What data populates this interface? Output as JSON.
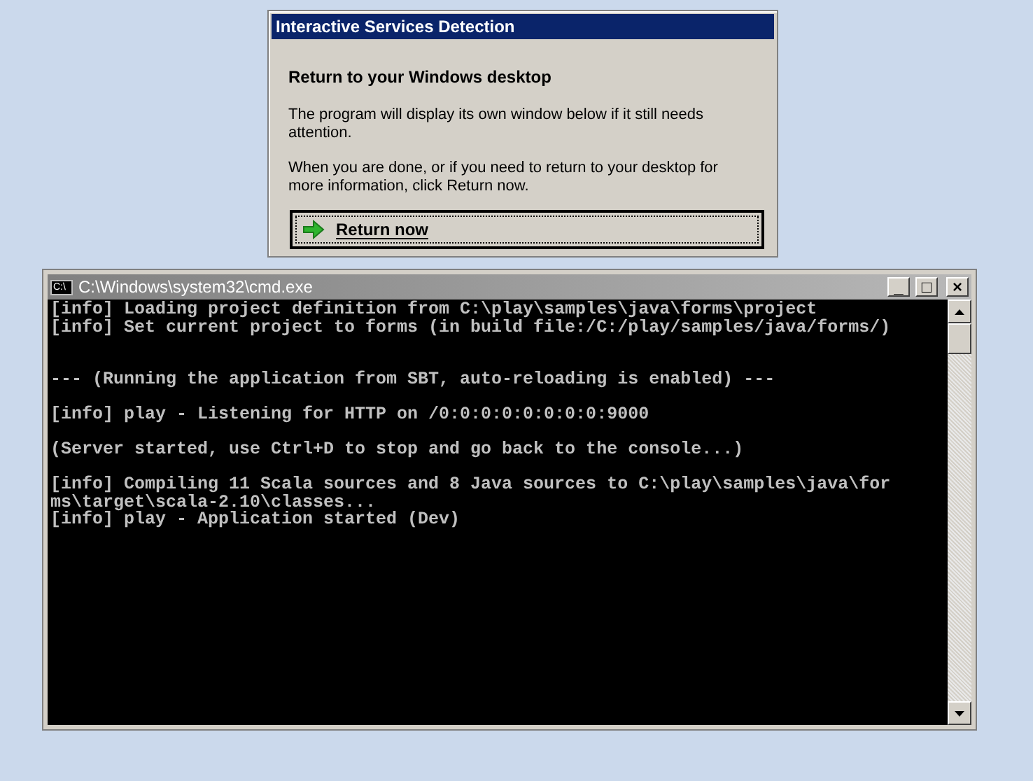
{
  "dialog": {
    "title": "Interactive Services Detection",
    "heading": "Return to your Windows desktop",
    "paragraphs": [
      "The program will display its own window below if it still needs attention.",
      "When you are done, or if you need to return to your desktop for more information, click Return now."
    ],
    "button": "Return now"
  },
  "console": {
    "title": "C:\\Windows\\system32\\cmd.exe",
    "icon_label": "C:\\",
    "controls": [
      "_",
      "□",
      "×"
    ],
    "blocks": [
      [
        "[info] Loading project definition from C:\\play\\samples\\java\\forms\\project",
        "[info] Set current project to forms (in build file:/C:/play/samples/java/forms/)"
      ],
      [
        "--- (Running the application from SBT, auto-reloading is enabled) ---"
      ],
      [
        "[info] play - Listening for HTTP on /0:0:0:0:0:0:0:0:9000"
      ],
      [
        "(Server started, use Ctrl+D to stop and go back to the console...)"
      ],
      [
        "[info] Compiling 11 Scala sources and 8 Java sources to C:\\play\\samples\\java\\for",
        "ms\\target\\scala-2.10\\classes...",
        "[info] play - Application started (Dev)"
      ]
    ]
  }
}
